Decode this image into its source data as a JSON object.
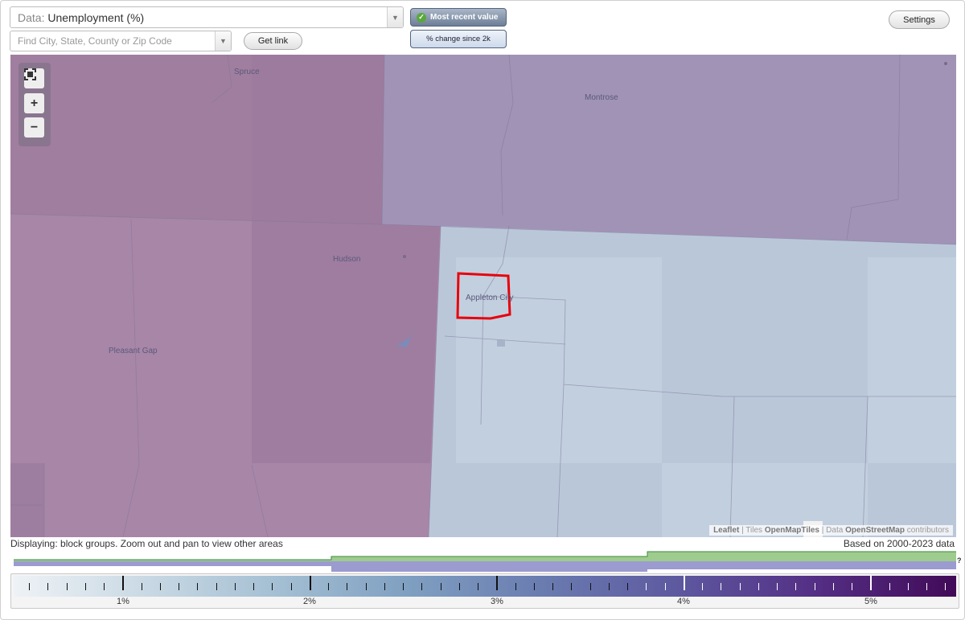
{
  "controls": {
    "data_label": "Data:",
    "data_value": "Unemployment (%)",
    "search_placeholder": "Find City, State, County or Zip Code",
    "get_link": "Get link",
    "mode_active": "Most recent value",
    "mode_alt": "% change since 2k",
    "settings": "Settings"
  },
  "icons": {
    "dropdown": "triangle-down-icon",
    "check": "check-icon",
    "fullscreen": "fullscreen-icon",
    "zoom_in": "plus-icon",
    "zoom_out": "minus-icon"
  },
  "map": {
    "places": [
      "Spruce",
      "Montrose",
      "Hudson",
      "Appleton City",
      "Pleasant Gap"
    ],
    "highlight_color": "#e8000b",
    "attribution": {
      "leaflet": "Leaflet",
      "tiles_prefix": "Tiles",
      "tiles": "OpenMapTiles",
      "data_prefix": "Data",
      "data": "OpenStreetMap",
      "data_suffix": "contributors"
    }
  },
  "status": {
    "displaying": "Displaying: block groups. Zoom out and pan to view other areas",
    "based_on": "Based on 2000-2023 data",
    "help": "?"
  },
  "legend": {
    "tick_labels": [
      "1%",
      "2%",
      "3%",
      "4%",
      "5%"
    ],
    "colors": {
      "low": "#eef2f6",
      "high": "#420a58",
      "hist_green": "#9ecc8e",
      "hist_purple": "#9b9bd0"
    }
  }
}
